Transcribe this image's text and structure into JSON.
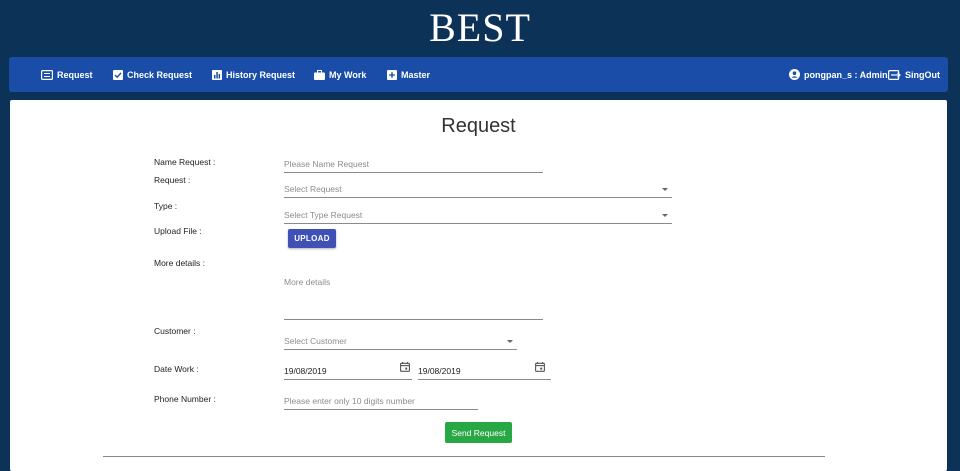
{
  "app": {
    "brand": "BEST"
  },
  "nav": {
    "items": [
      {
        "label": "Request",
        "icon": "list-alt-icon"
      },
      {
        "label": "Check Request",
        "icon": "check-square-icon"
      },
      {
        "label": "History Request",
        "icon": "bar-chart-icon"
      },
      {
        "label": "My Work",
        "icon": "briefcase-icon"
      },
      {
        "label": "Master",
        "icon": "plus-square-icon"
      }
    ],
    "user": {
      "label": "pongpan_s : Admin",
      "icon": "account-circle-icon"
    },
    "signout": {
      "label": "SingOut",
      "icon": "exit-icon"
    }
  },
  "form": {
    "title": "Request",
    "name_request": {
      "label": "Name Request :",
      "placeholder": "Please Name Request",
      "value": ""
    },
    "request": {
      "label": "Request :",
      "placeholder": "Select Request"
    },
    "type": {
      "label": "Type :",
      "placeholder": "Select Type Request"
    },
    "upload": {
      "label": "Upload File :",
      "button": "UPLOAD"
    },
    "details": {
      "label": "More details :",
      "placeholder": "More details"
    },
    "customer": {
      "label": "Customer :",
      "placeholder": "Select Customer"
    },
    "date_work": {
      "label": "Date Work :",
      "start": "19/08/2019",
      "end": "19/08/2019"
    },
    "phone": {
      "label": "Phone Number :",
      "placeholder": "Please enter only 10 digits number"
    },
    "submit": "Send Request"
  },
  "colors": {
    "background": "#0d3257",
    "navbar": "#1a4da8",
    "upload_button": "#3f51b5",
    "submit_button": "#28a745"
  }
}
